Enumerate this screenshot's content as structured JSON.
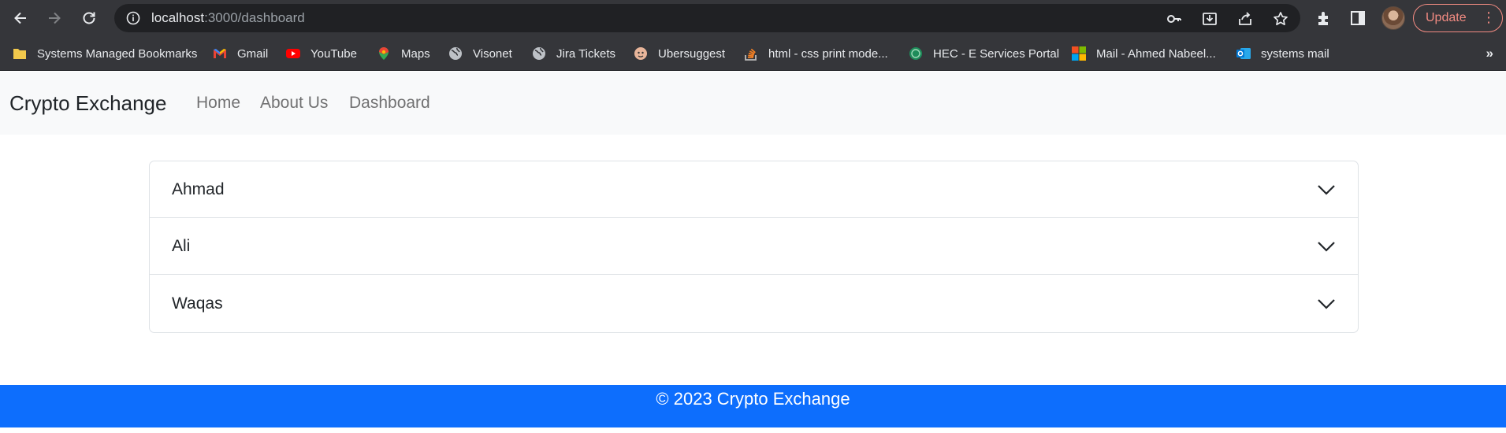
{
  "browser": {
    "url_host": "localhost",
    "url_rest": ":3000/dashboard",
    "update_label": "Update",
    "bookmarks": [
      {
        "label": "Systems Managed Bookmarks",
        "icon": "folder-icon",
        "color": "#f2c94c"
      },
      {
        "label": "Gmail",
        "icon": "gmail-icon",
        "color": "#ea4335"
      },
      {
        "label": "YouTube",
        "icon": "youtube-icon",
        "color": "#ff0000"
      },
      {
        "label": "Maps",
        "icon": "maps-icon",
        "color": "#34a853"
      },
      {
        "label": "Visonet",
        "icon": "globe-icon",
        "color": "#bdc1c6"
      },
      {
        "label": "Jira Tickets",
        "icon": "globe-icon",
        "color": "#bdc1c6"
      },
      {
        "label": "Ubersuggest",
        "icon": "ubersuggest-icon",
        "color": "#e8b59a"
      },
      {
        "label": "html - css print mode...",
        "icon": "stackoverflow-icon",
        "color": "#f48024"
      },
      {
        "label": "HEC - E Services Portal",
        "icon": "hec-icon",
        "color": "#1e8c5a"
      },
      {
        "label": "Mail - Ahmed Nabeel...",
        "icon": "microsoft-icon",
        "color": "#f25022"
      },
      {
        "label": "systems mail",
        "icon": "outlook-icon",
        "color": "#0078d4"
      }
    ],
    "more_label": "»"
  },
  "navbar": {
    "brand": "Crypto Exchange",
    "links": [
      "Home",
      "About Us",
      "Dashboard"
    ]
  },
  "accordion": {
    "items": [
      "Ahmad",
      "Ali",
      "Waqas"
    ]
  },
  "footer": {
    "text": "© 2023 Crypto Exchange"
  },
  "colors": {
    "footer_bg": "#0d6efd",
    "navbar_bg": "#f8f9fa",
    "update_accent": "#f28b82"
  }
}
